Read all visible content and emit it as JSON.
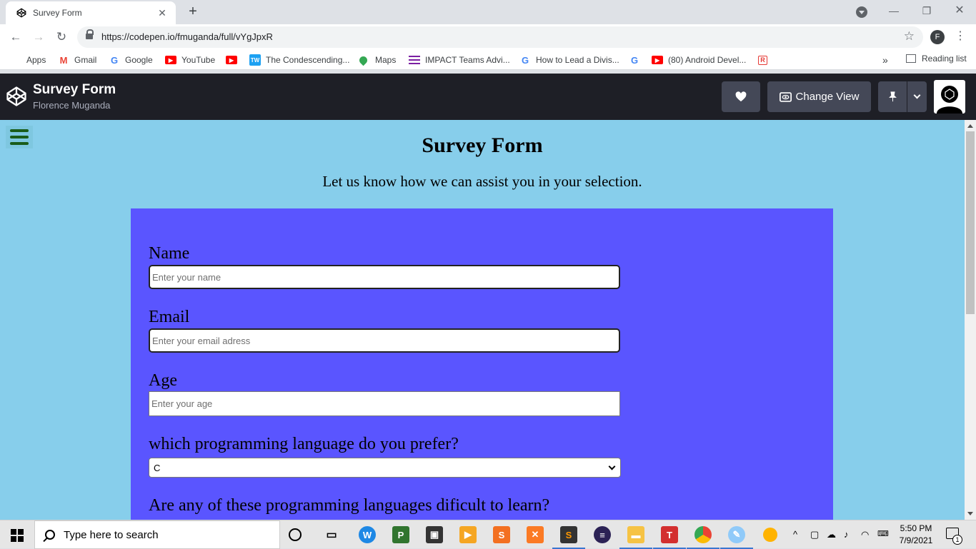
{
  "browser": {
    "tab": {
      "title": "Survey Form",
      "close": "✕"
    },
    "new_tab": "+",
    "window": {
      "minimize": "—",
      "restore": "❐",
      "close": "✕"
    },
    "nav": {
      "back": "←",
      "forward": "→",
      "reload": "↻"
    },
    "url": "https://codepen.io/fmuganda/full/vYgJpxR",
    "profile_initial": "F",
    "menu": "⋮",
    "star": "☆",
    "bookmarks": [
      {
        "label": "Apps",
        "icon": "apps-grid-icon",
        "color": "#4285f4"
      },
      {
        "label": "Gmail",
        "icon": "gmail-icon",
        "color": "#ea4335"
      },
      {
        "label": "Google",
        "icon": "google-icon",
        "color": "#4285f4"
      },
      {
        "label": "YouTube",
        "icon": "youtube-icon",
        "color": "#ff0000"
      },
      {
        "label": "",
        "icon": "youtube-icon",
        "color": "#ff0000"
      },
      {
        "label": "The Condescending...",
        "icon": "tw-icon",
        "color": "#1da1f2"
      },
      {
        "label": "Maps",
        "icon": "maps-pin-icon",
        "color": "#34a853"
      },
      {
        "label": "IMPACT Teams Advi...",
        "icon": "stack-icon",
        "color": "#7b1fa2"
      },
      {
        "label": "How to Lead a Divis...",
        "icon": "google-icon",
        "color": "#4285f4"
      },
      {
        "label": "",
        "icon": "google-icon",
        "color": "#4285f4"
      },
      {
        "label": "(80) Android Devel...",
        "icon": "youtube-icon",
        "color": "#ff0000"
      },
      {
        "label": "",
        "icon": "r-icon",
        "color": "#e53935"
      }
    ],
    "bookmarks_more": "»",
    "reading_list": "Reading list"
  },
  "codepen": {
    "title": "Survey Form",
    "author": "Florence Muganda",
    "change_view": "Change View"
  },
  "page": {
    "title": "Survey Form",
    "description": "Let us know how we can assist you in your selection.",
    "form": {
      "name_label": "Name",
      "name_placeholder": "Enter your name",
      "email_label": "Email",
      "email_placeholder": "Enter your email adress",
      "age_label": "Age",
      "age_placeholder": "Enter your age",
      "language_label": "which programming language do you prefer?",
      "language_selected": "C",
      "difficult_label": "Are any of these programming languages dificult to learn?"
    },
    "colors": {
      "background": "#87ceeb",
      "form": "#5a55ff"
    }
  },
  "taskbar": {
    "search_placeholder": "Type here to search",
    "time": "5:50 PM",
    "date": "7/9/2021",
    "notification_count": "1"
  }
}
